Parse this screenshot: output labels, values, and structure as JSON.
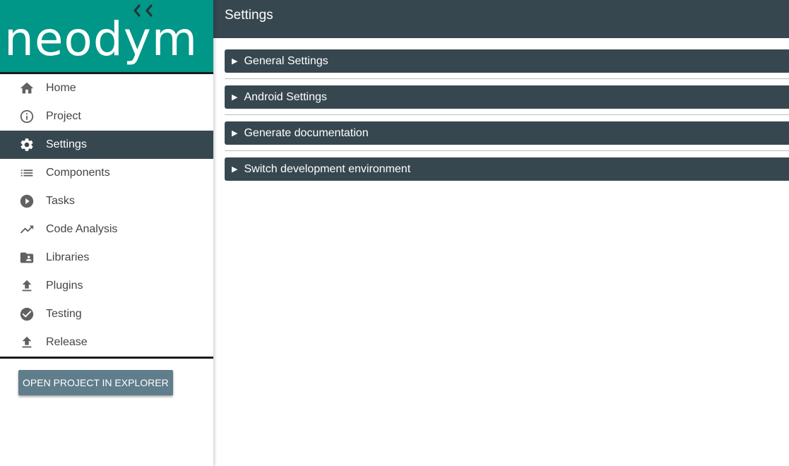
{
  "app": {
    "logo_text": "neodym"
  },
  "sidebar": {
    "items": [
      {
        "label": "Home",
        "icon": "home-icon"
      },
      {
        "label": "Project",
        "icon": "info-icon"
      },
      {
        "label": "Settings",
        "icon": "gear-icon",
        "active": true
      },
      {
        "label": "Components",
        "icon": "list-icon"
      },
      {
        "label": "Tasks",
        "icon": "play-icon"
      },
      {
        "label": "Code Analysis",
        "icon": "trending-up-icon"
      },
      {
        "label": "Libraries",
        "icon": "folder-user-icon"
      },
      {
        "label": "Plugins",
        "icon": "upload-icon"
      },
      {
        "label": "Testing",
        "icon": "check-circle-icon"
      },
      {
        "label": "Release",
        "icon": "upload-icon"
      }
    ],
    "open_button": "OPEN PROJECT IN EXPLORER"
  },
  "header": {
    "title": "Settings"
  },
  "main": {
    "panels": [
      {
        "label": "General Settings"
      },
      {
        "label": "Android Settings"
      },
      {
        "label": "Generate documentation"
      },
      {
        "label": "Switch development environment"
      }
    ]
  },
  "colors": {
    "brand": "#009688",
    "dark": "#37474f",
    "button": "#607d8b"
  }
}
